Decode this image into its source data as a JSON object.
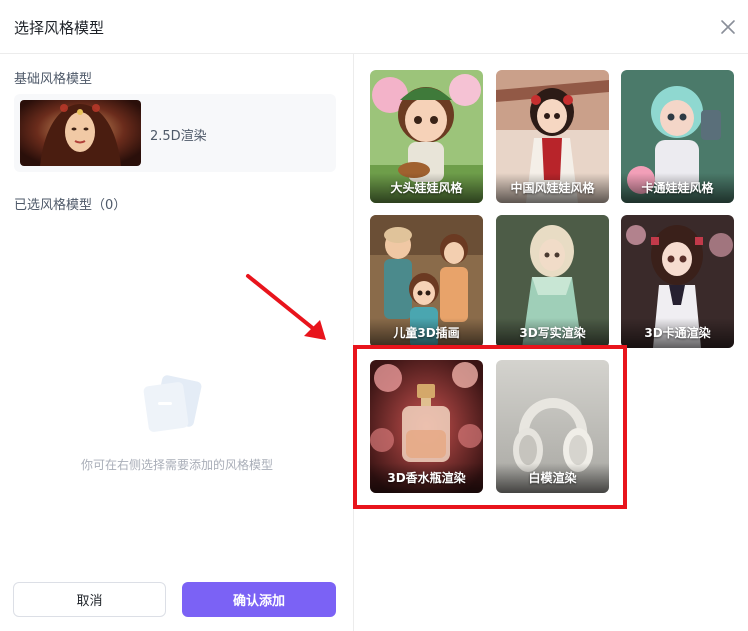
{
  "dialog": {
    "title": "选择风格模型"
  },
  "left": {
    "base_label": "基础风格模型",
    "base_model": {
      "name": "2.5D渲染"
    },
    "selected_label": "已选风格模型（0）",
    "empty_text": "你可在右侧选择需要添加的风格模型",
    "cancel_label": "取消",
    "confirm_label": "确认添加"
  },
  "styles": [
    {
      "label": "大头娃娃风格"
    },
    {
      "label": "中国风娃娃风格"
    },
    {
      "label": "卡通娃娃风格"
    },
    {
      "label": "儿童3D插画"
    },
    {
      "label": "3D写实渲染"
    },
    {
      "label": "3D卡通渲染"
    },
    {
      "label": "3D香水瓶渲染"
    },
    {
      "label": "白模渲染"
    }
  ],
  "colors": {
    "accent": "#7b62f5",
    "highlight": "#e8141c"
  }
}
